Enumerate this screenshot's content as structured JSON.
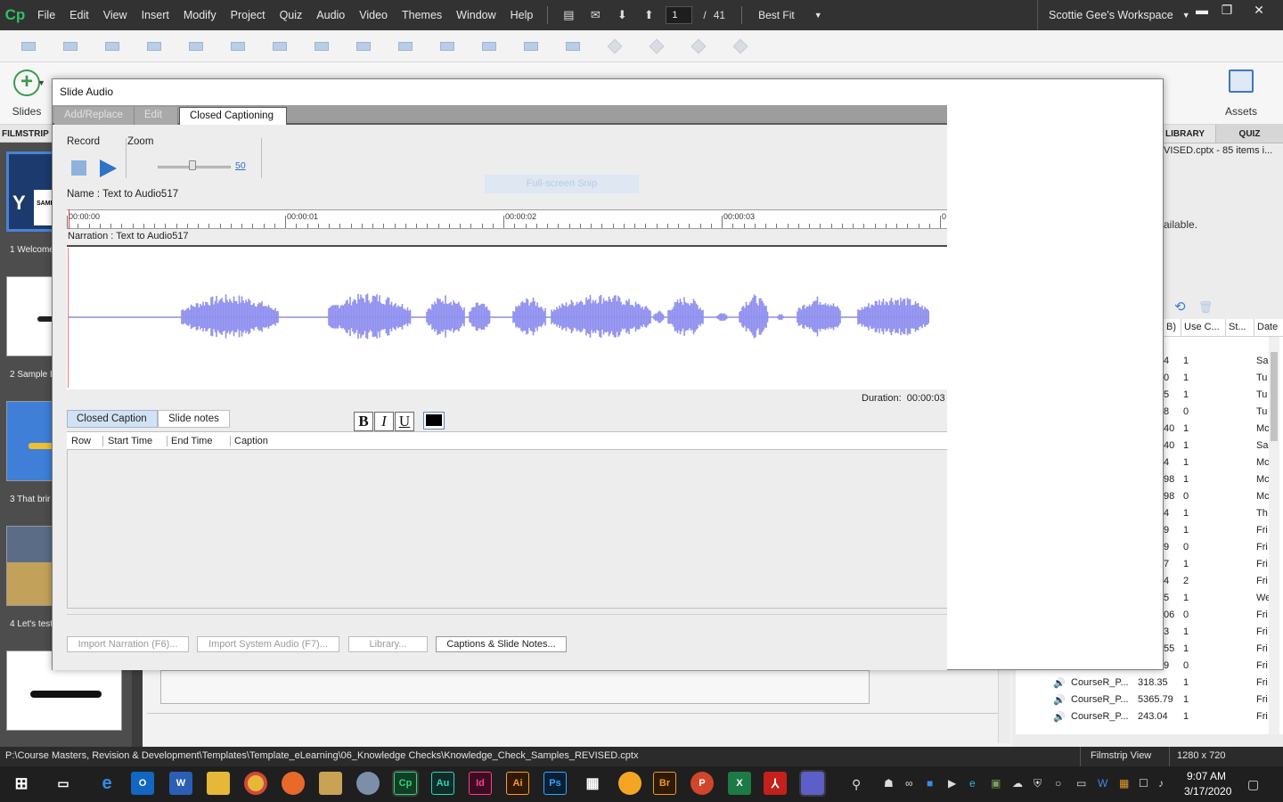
{
  "app": {
    "logo": "Cp",
    "menu": [
      "File",
      "Edit",
      "View",
      "Insert",
      "Modify",
      "Project",
      "Quiz",
      "Audio",
      "Video",
      "Themes",
      "Window",
      "Help"
    ],
    "page_current": "1",
    "page_separator": "/",
    "page_total": "41",
    "fit": "Best Fit",
    "workspace": "Scottie Gee's Workspace",
    "window_buttons": {
      "minimize": "▬",
      "restore": "❐",
      "close": "✕"
    }
  },
  "ribbon": {
    "slides_label": "Slides",
    "assets_label": "Assets"
  },
  "filmstrip": {
    "header": "FILMSTRIP",
    "slides": [
      {
        "label": "1 Welcome"
      },
      {
        "label": "2 Sample E"
      },
      {
        "label": "3 That brir"
      },
      {
        "label": "4 Let's test"
      },
      {
        "label": ""
      }
    ],
    "thumb_texts": {
      "s1_big": "Y",
      "s1_small": "SAMP"
    }
  },
  "library": {
    "tab_library": "LIBRARY",
    "tab_quiz": "QUIZ",
    "file_info": "VISED.cptx - 85 items i...",
    "available_text": "ailable.",
    "tools": {
      "link_icon": "⟲",
      "trash_icon": "🗑"
    },
    "columns": [
      "B)",
      "Use C...",
      "St...",
      "Date"
    ],
    "rows": [
      {
        "name": "",
        "size": "4",
        "use": "1",
        "date": "Sa"
      },
      {
        "name": "",
        "size": "0",
        "use": "1",
        "date": "Tu"
      },
      {
        "name": "",
        "size": "5",
        "use": "1",
        "date": "Tu"
      },
      {
        "name": "",
        "size": "8",
        "use": "0",
        "date": "Tu"
      },
      {
        "name": "",
        "size": "40",
        "use": "1",
        "date": "Mc"
      },
      {
        "name": "",
        "size": "40",
        "use": "1",
        "date": "Sa"
      },
      {
        "name": "",
        "size": "4",
        "use": "1",
        "date": "Mc"
      },
      {
        "name": "",
        "size": "98",
        "use": "1",
        "date": "Mc"
      },
      {
        "name": "",
        "size": "98",
        "use": "0",
        "date": "Mc"
      },
      {
        "name": "",
        "size": "4",
        "use": "1",
        "date": "Th"
      },
      {
        "name": "",
        "size": "9",
        "use": "1",
        "date": "Fri"
      },
      {
        "name": "",
        "size": "9",
        "use": "0",
        "date": "Fri"
      },
      {
        "name": "",
        "size": "7",
        "use": "1",
        "date": "Fri"
      },
      {
        "name": "",
        "size": "4",
        "use": "2",
        "date": "Fri"
      },
      {
        "name": "",
        "size": "5",
        "use": "1",
        "date": "We"
      },
      {
        "name": "",
        "size": "06",
        "use": "0",
        "date": "Fri"
      },
      {
        "name": "",
        "size": "3",
        "use": "1",
        "date": "Fri"
      },
      {
        "name": "",
        "size": "55",
        "use": "1",
        "date": "Fri"
      },
      {
        "name": "",
        "size": "9",
        "use": "0",
        "date": "Fri"
      },
      {
        "name": "CourseR_P...",
        "size": "318.35",
        "use": "1",
        "date": "Fri"
      },
      {
        "name": "CourseR_P...",
        "size": "5365.79",
        "use": "1",
        "date": "Fri"
      },
      {
        "name": "CourseR_P...",
        "size": "243.04",
        "use": "1",
        "date": "Fri"
      }
    ]
  },
  "dialog": {
    "title": "Slide Audio",
    "tabs": [
      "Add/Replace",
      "Edit",
      "Closed Captioning"
    ],
    "active_tab": "Closed Captioning",
    "record_label": "Record",
    "zoom_label": "Zoom",
    "zoom_value": "50",
    "zoom_level_fraction": 0.5,
    "name_label": "Name :",
    "name_value": "Text to Audio517",
    "snip_text": "Full-screen Snip",
    "ruler_labels": [
      "00:00:00",
      "00:00:01",
      "00:00:02",
      "00:00:03",
      "0"
    ],
    "narration_label": "Narration : Text to Audio517",
    "duration_label": "Duration:",
    "duration_value": "00:00:03",
    "subtabs": [
      "Closed Caption",
      "Slide notes"
    ],
    "format_buttons": {
      "bold": "B",
      "italic": "I",
      "underline": "U"
    },
    "caption_columns": [
      "Row",
      "Start Time",
      "End Time",
      "Caption"
    ],
    "bottom_buttons": [
      "Import Narration (F6)...",
      "Import System Audio (F7)...",
      "Library...",
      "Captions & Slide Notes..."
    ]
  },
  "status": {
    "path": "P:\\Course Masters, Revision  &  Development\\Templates\\Template_eLearning\\06_Knowledge Checks\\Knowledge_Check_Samples_REVISED.cptx",
    "view": "Filmstrip View",
    "size": "1280 x 720"
  },
  "taskbar": {
    "apps": [
      "O",
      "W",
      "Au",
      "Id",
      "Ai",
      "Ps",
      "Br",
      "P",
      "X"
    ],
    "cp_app": "Cp",
    "time": "9:07 AM",
    "date": "3/17/2020"
  },
  "colors": {
    "waveform": "#9090f0",
    "accent": "#2e73c8",
    "menubar": "#323232",
    "active_tab": "#ffffff"
  }
}
